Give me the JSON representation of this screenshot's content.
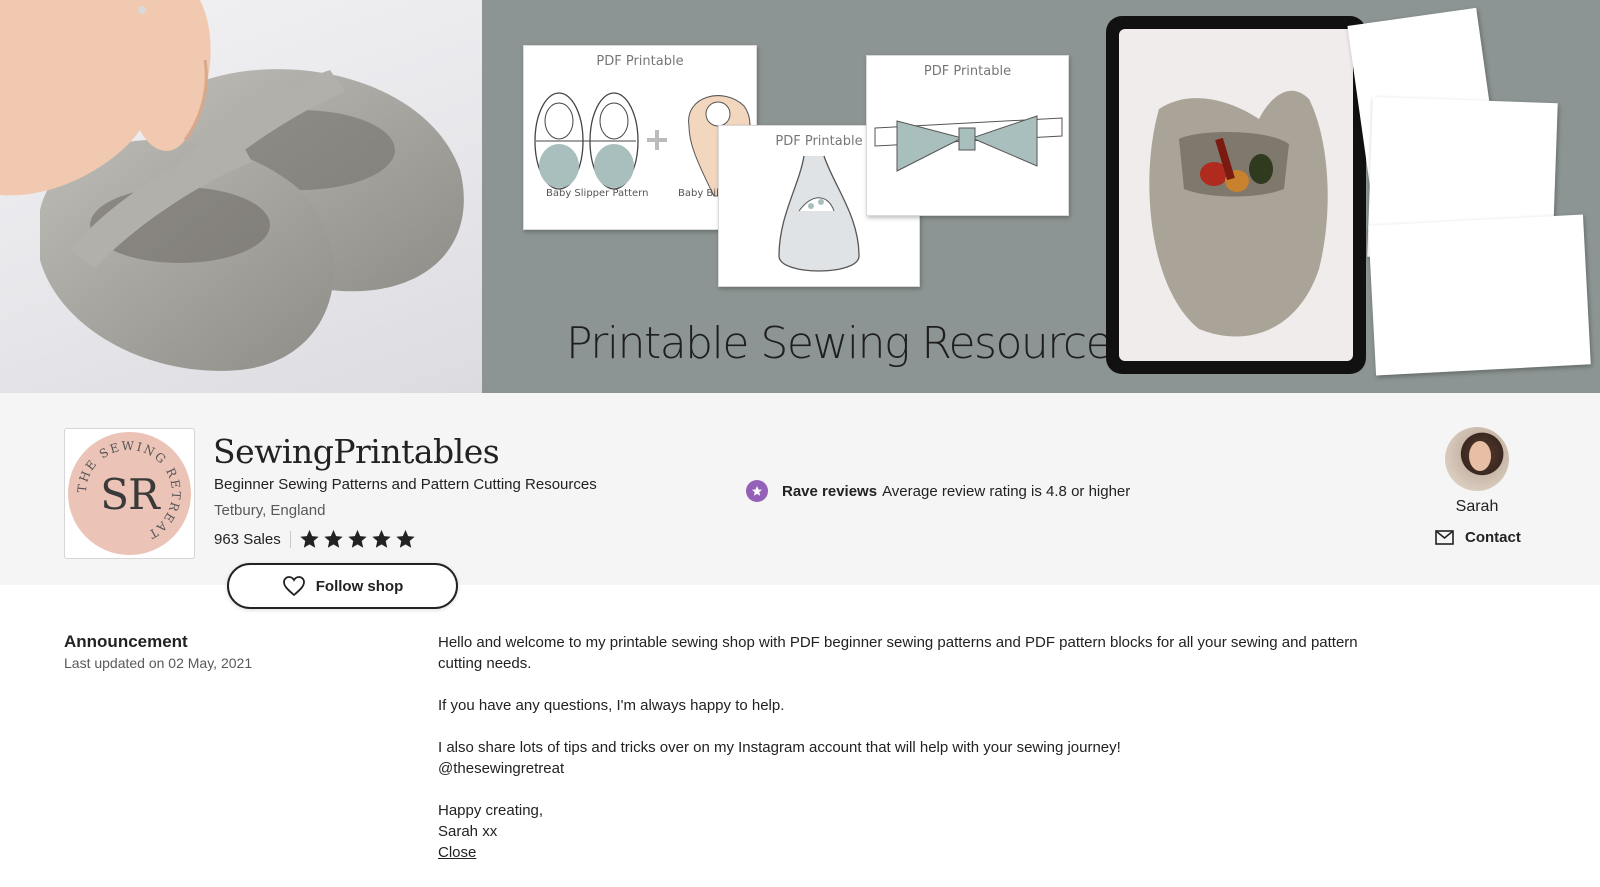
{
  "banner": {
    "card_label": "PDF Printable",
    "slipper_caption": "Baby Slipper Pattern",
    "bib_caption": "Baby Bib P",
    "title": "Printable Sewing Resources"
  },
  "shop": {
    "logo_initials": "SR",
    "logo_ring_text": "THE SEWING RETREAT",
    "name": "SewingPrintables",
    "title": "Beginner Sewing Patterns and Pattern Cutting Resources",
    "location": "Tetbury, England",
    "sales": "963 Sales",
    "rating_stars": 5,
    "follow_label": "Follow shop"
  },
  "rave_reviews": {
    "title": "Rave reviews",
    "description": "Average review rating is 4.8 or higher"
  },
  "owner": {
    "name": "Sarah",
    "contact_label": "Contact"
  },
  "announcement": {
    "heading": "Announcement",
    "updated": "Last updated on 02 May, 2021",
    "p1": "Hello and welcome to my printable sewing shop with PDF beginner sewing patterns and PDF pattern blocks for all your sewing and pattern cutting needs.",
    "p2": "If you have any questions, I'm always happy to help.",
    "p3a": "I also share lots of tips and tricks over on my Instagram account that will help with your sewing journey!",
    "p3b": "@thesewingretreat",
    "p4a": "Happy creating,",
    "p4b": "Sarah xx",
    "close_label": "Close"
  },
  "colors": {
    "banner_gray": "#8c9593",
    "logo_pink": "#ebc4b7",
    "rave_purple": "#9560b8",
    "header_bg": "#f5f5f5"
  },
  "icons": [
    "heart-icon",
    "star-icon",
    "rave-badge-icon",
    "mail-icon"
  ]
}
